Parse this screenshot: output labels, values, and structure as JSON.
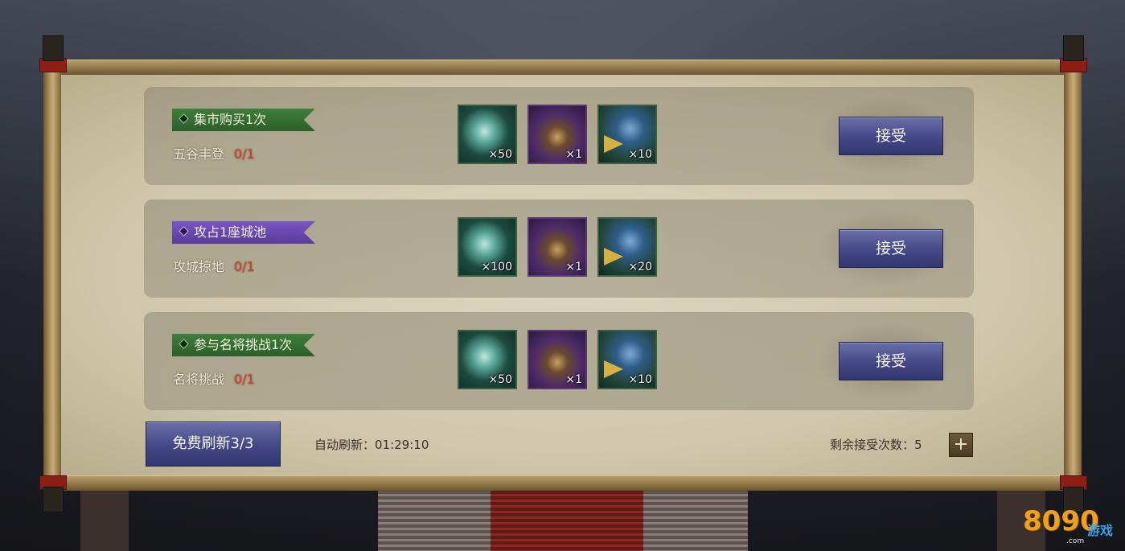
{
  "tasks": [
    {
      "tag": "集市购买1次",
      "tag_color": "green",
      "name": "五谷丰登",
      "progress": "0/1",
      "rewards": [
        {
          "icon": "jade-pendant-icon",
          "qty": "×50"
        },
        {
          "icon": "armor-chest-icon",
          "qty": "×1"
        },
        {
          "icon": "troops-icon",
          "qty": "×10"
        }
      ],
      "accept_label": "接受"
    },
    {
      "tag": "攻占1座城池",
      "tag_color": "purple",
      "name": "攻城掠地",
      "progress": "0/1",
      "rewards": [
        {
          "icon": "jade-pendant-icon",
          "qty": "×100"
        },
        {
          "icon": "armor-chest-icon",
          "qty": "×1"
        },
        {
          "icon": "troops-icon",
          "qty": "×20"
        }
      ],
      "accept_label": "接受"
    },
    {
      "tag": "参与名将挑战1次",
      "tag_color": "green",
      "name": "名将挑战",
      "progress": "0/1",
      "rewards": [
        {
          "icon": "jade-pendant-icon",
          "qty": "×50"
        },
        {
          "icon": "armor-chest-icon",
          "qty": "×1"
        },
        {
          "icon": "troops-icon",
          "qty": "×10"
        }
      ],
      "accept_label": "接受"
    }
  ],
  "footer": {
    "refresh_button": "免费刷新3/3",
    "auto_refresh": "自动刷新：01:29:10",
    "remaining": "剩余接受次数：5",
    "plus": "+"
  },
  "logo": {
    "number": "8090",
    "game": "游戏",
    "domain": ".com"
  },
  "colors": {
    "accept_button": "#434886",
    "progress_red": "#e03a2a",
    "tag_green": "#3e7e3c",
    "tag_purple": "#7a55c4"
  }
}
